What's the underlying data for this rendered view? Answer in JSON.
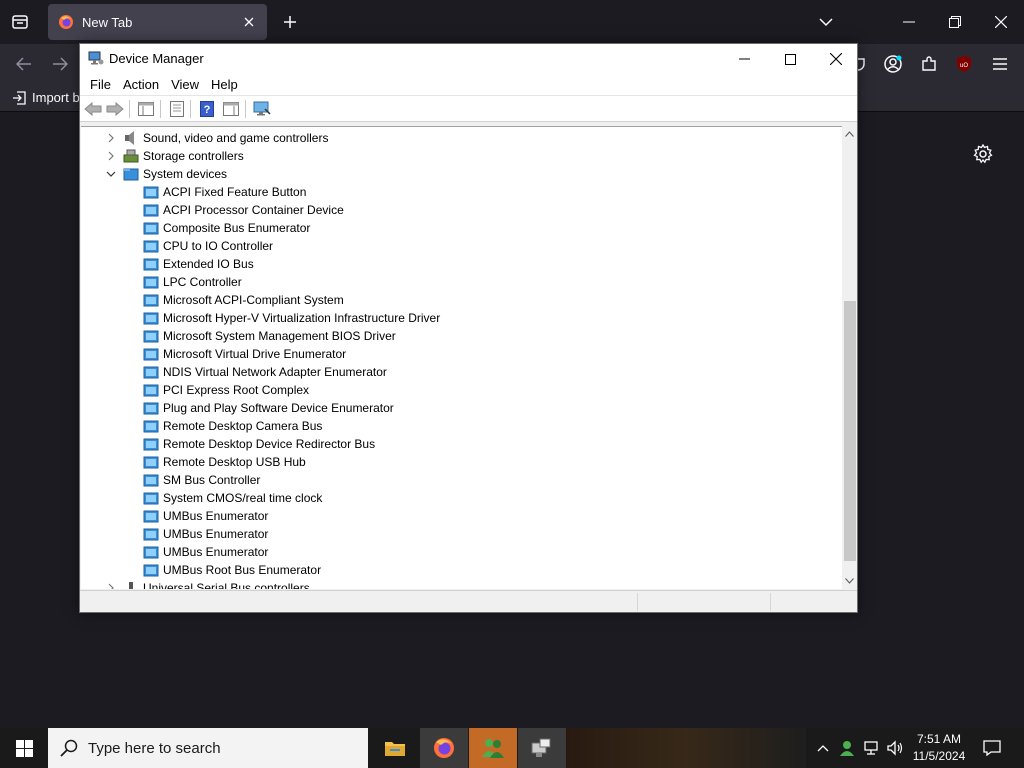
{
  "browser": {
    "tab_title": "New Tab",
    "import_label": "Import b"
  },
  "device_manager": {
    "window_title": "Device Manager",
    "menu": [
      "File",
      "Action",
      "View",
      "Help"
    ],
    "tree": [
      {
        "label": "Sound, video and game controllers",
        "level": 0,
        "expander": "collapsed",
        "icon": "speaker-icon"
      },
      {
        "label": "Storage controllers",
        "level": 0,
        "expander": "collapsed",
        "icon": "storage-controller-icon"
      },
      {
        "label": "System devices",
        "level": 0,
        "expander": "expanded",
        "icon": "system-folder-icon"
      },
      {
        "label": "ACPI Fixed Feature Button",
        "level": 1,
        "icon": "device-icon"
      },
      {
        "label": "ACPI Processor Container Device",
        "level": 1,
        "icon": "device-icon"
      },
      {
        "label": "Composite Bus Enumerator",
        "level": 1,
        "icon": "device-icon"
      },
      {
        "label": "CPU to IO Controller",
        "level": 1,
        "icon": "device-icon"
      },
      {
        "label": "Extended IO Bus",
        "level": 1,
        "icon": "device-icon"
      },
      {
        "label": "LPC Controller",
        "level": 1,
        "icon": "device-icon"
      },
      {
        "label": "Microsoft ACPI-Compliant System",
        "level": 1,
        "icon": "device-icon"
      },
      {
        "label": "Microsoft Hyper-V Virtualization Infrastructure Driver",
        "level": 1,
        "icon": "device-icon"
      },
      {
        "label": "Microsoft System Management BIOS Driver",
        "level": 1,
        "icon": "device-icon"
      },
      {
        "label": "Microsoft Virtual Drive Enumerator",
        "level": 1,
        "icon": "device-icon"
      },
      {
        "label": "NDIS Virtual Network Adapter Enumerator",
        "level": 1,
        "icon": "device-icon"
      },
      {
        "label": "PCI Express Root Complex",
        "level": 1,
        "icon": "device-icon"
      },
      {
        "label": "Plug and Play Software Device Enumerator",
        "level": 1,
        "icon": "device-icon"
      },
      {
        "label": "Remote Desktop Camera Bus",
        "level": 1,
        "icon": "device-icon"
      },
      {
        "label": "Remote Desktop Device Redirector Bus",
        "level": 1,
        "icon": "device-icon"
      },
      {
        "label": "Remote Desktop USB Hub",
        "level": 1,
        "icon": "device-icon"
      },
      {
        "label": "SM Bus Controller",
        "level": 1,
        "icon": "device-icon"
      },
      {
        "label": "System CMOS/real time clock",
        "level": 1,
        "icon": "device-icon"
      },
      {
        "label": "UMBus Enumerator",
        "level": 1,
        "icon": "device-icon"
      },
      {
        "label": "UMBus Enumerator",
        "level": 1,
        "icon": "device-icon"
      },
      {
        "label": "UMBus Enumerator",
        "level": 1,
        "icon": "device-icon"
      },
      {
        "label": "UMBus Root Bus Enumerator",
        "level": 1,
        "icon": "device-icon"
      },
      {
        "label": "Universal Serial Bus controllers",
        "level": 0,
        "expander": "collapsed",
        "icon": "usb-icon"
      }
    ]
  },
  "taskbar": {
    "search_placeholder": "Type here to search",
    "time": "7:51 AM",
    "date": "11/5/2024"
  },
  "colors": {
    "browser_bg": "#1c1b22",
    "toolbar_bg": "#2b2a33",
    "active_taskbar_app": "#c36a27"
  }
}
